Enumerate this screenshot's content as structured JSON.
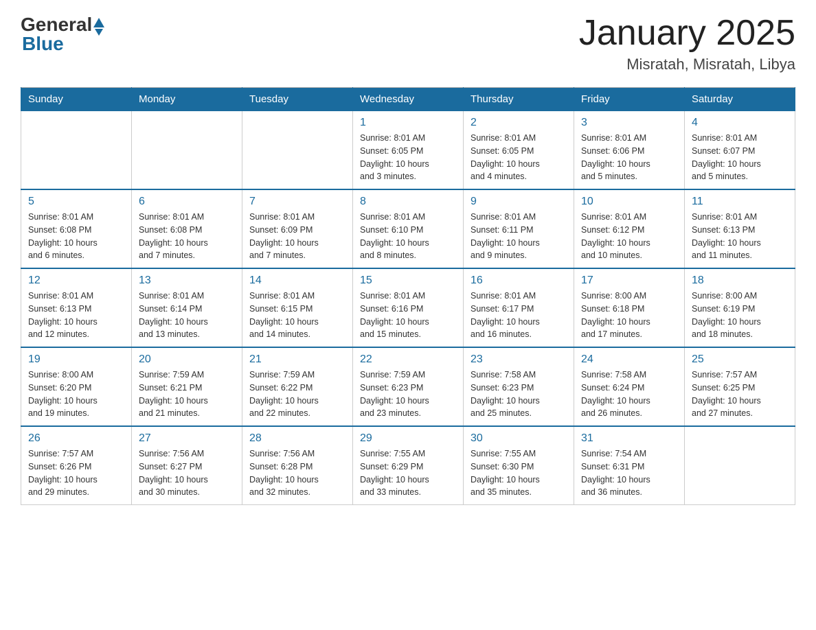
{
  "header": {
    "logo_general": "General",
    "logo_blue": "Blue",
    "title": "January 2025",
    "subtitle": "Misratah, Misratah, Libya"
  },
  "days_of_week": [
    "Sunday",
    "Monday",
    "Tuesday",
    "Wednesday",
    "Thursday",
    "Friday",
    "Saturday"
  ],
  "weeks": [
    [
      {
        "day": "",
        "info": ""
      },
      {
        "day": "",
        "info": ""
      },
      {
        "day": "",
        "info": ""
      },
      {
        "day": "1",
        "info": "Sunrise: 8:01 AM\nSunset: 6:05 PM\nDaylight: 10 hours\nand 3 minutes."
      },
      {
        "day": "2",
        "info": "Sunrise: 8:01 AM\nSunset: 6:05 PM\nDaylight: 10 hours\nand 4 minutes."
      },
      {
        "day": "3",
        "info": "Sunrise: 8:01 AM\nSunset: 6:06 PM\nDaylight: 10 hours\nand 5 minutes."
      },
      {
        "day": "4",
        "info": "Sunrise: 8:01 AM\nSunset: 6:07 PM\nDaylight: 10 hours\nand 5 minutes."
      }
    ],
    [
      {
        "day": "5",
        "info": "Sunrise: 8:01 AM\nSunset: 6:08 PM\nDaylight: 10 hours\nand 6 minutes."
      },
      {
        "day": "6",
        "info": "Sunrise: 8:01 AM\nSunset: 6:08 PM\nDaylight: 10 hours\nand 7 minutes."
      },
      {
        "day": "7",
        "info": "Sunrise: 8:01 AM\nSunset: 6:09 PM\nDaylight: 10 hours\nand 7 minutes."
      },
      {
        "day": "8",
        "info": "Sunrise: 8:01 AM\nSunset: 6:10 PM\nDaylight: 10 hours\nand 8 minutes."
      },
      {
        "day": "9",
        "info": "Sunrise: 8:01 AM\nSunset: 6:11 PM\nDaylight: 10 hours\nand 9 minutes."
      },
      {
        "day": "10",
        "info": "Sunrise: 8:01 AM\nSunset: 6:12 PM\nDaylight: 10 hours\nand 10 minutes."
      },
      {
        "day": "11",
        "info": "Sunrise: 8:01 AM\nSunset: 6:13 PM\nDaylight: 10 hours\nand 11 minutes."
      }
    ],
    [
      {
        "day": "12",
        "info": "Sunrise: 8:01 AM\nSunset: 6:13 PM\nDaylight: 10 hours\nand 12 minutes."
      },
      {
        "day": "13",
        "info": "Sunrise: 8:01 AM\nSunset: 6:14 PM\nDaylight: 10 hours\nand 13 minutes."
      },
      {
        "day": "14",
        "info": "Sunrise: 8:01 AM\nSunset: 6:15 PM\nDaylight: 10 hours\nand 14 minutes."
      },
      {
        "day": "15",
        "info": "Sunrise: 8:01 AM\nSunset: 6:16 PM\nDaylight: 10 hours\nand 15 minutes."
      },
      {
        "day": "16",
        "info": "Sunrise: 8:01 AM\nSunset: 6:17 PM\nDaylight: 10 hours\nand 16 minutes."
      },
      {
        "day": "17",
        "info": "Sunrise: 8:00 AM\nSunset: 6:18 PM\nDaylight: 10 hours\nand 17 minutes."
      },
      {
        "day": "18",
        "info": "Sunrise: 8:00 AM\nSunset: 6:19 PM\nDaylight: 10 hours\nand 18 minutes."
      }
    ],
    [
      {
        "day": "19",
        "info": "Sunrise: 8:00 AM\nSunset: 6:20 PM\nDaylight: 10 hours\nand 19 minutes."
      },
      {
        "day": "20",
        "info": "Sunrise: 7:59 AM\nSunset: 6:21 PM\nDaylight: 10 hours\nand 21 minutes."
      },
      {
        "day": "21",
        "info": "Sunrise: 7:59 AM\nSunset: 6:22 PM\nDaylight: 10 hours\nand 22 minutes."
      },
      {
        "day": "22",
        "info": "Sunrise: 7:59 AM\nSunset: 6:23 PM\nDaylight: 10 hours\nand 23 minutes."
      },
      {
        "day": "23",
        "info": "Sunrise: 7:58 AM\nSunset: 6:23 PM\nDaylight: 10 hours\nand 25 minutes."
      },
      {
        "day": "24",
        "info": "Sunrise: 7:58 AM\nSunset: 6:24 PM\nDaylight: 10 hours\nand 26 minutes."
      },
      {
        "day": "25",
        "info": "Sunrise: 7:57 AM\nSunset: 6:25 PM\nDaylight: 10 hours\nand 27 minutes."
      }
    ],
    [
      {
        "day": "26",
        "info": "Sunrise: 7:57 AM\nSunset: 6:26 PM\nDaylight: 10 hours\nand 29 minutes."
      },
      {
        "day": "27",
        "info": "Sunrise: 7:56 AM\nSunset: 6:27 PM\nDaylight: 10 hours\nand 30 minutes."
      },
      {
        "day": "28",
        "info": "Sunrise: 7:56 AM\nSunset: 6:28 PM\nDaylight: 10 hours\nand 32 minutes."
      },
      {
        "day": "29",
        "info": "Sunrise: 7:55 AM\nSunset: 6:29 PM\nDaylight: 10 hours\nand 33 minutes."
      },
      {
        "day": "30",
        "info": "Sunrise: 7:55 AM\nSunset: 6:30 PM\nDaylight: 10 hours\nand 35 minutes."
      },
      {
        "day": "31",
        "info": "Sunrise: 7:54 AM\nSunset: 6:31 PM\nDaylight: 10 hours\nand 36 minutes."
      },
      {
        "day": "",
        "info": ""
      }
    ]
  ]
}
